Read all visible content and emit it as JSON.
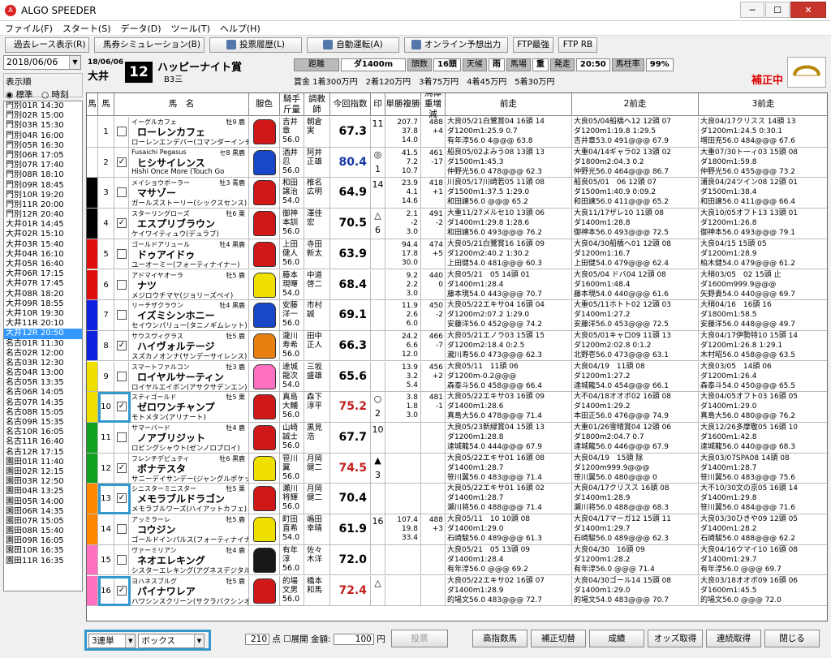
{
  "app": {
    "title": "ALGO SPEEDER"
  },
  "menu": [
    "ファイル(F)",
    "スタート(S)",
    "データ(D)",
    "ツール(T)",
    "ヘルプ(H)"
  ],
  "toolbar": [
    "過去レース表示(R)",
    "馬券シミュレーション(B)",
    "投票履歴(L)",
    "自動運転(A)",
    "オンライン予想出力",
    "FTP最強",
    "FTP RB"
  ],
  "sidebar": {
    "date": "2018/06/06",
    "order_label": "表示順",
    "radio1": "標準",
    "radio2": "時刻",
    "races": [
      "門別01R 14:30",
      "門別02R 15:00",
      "門別03R 15:30",
      "門別04R 16:00",
      "門別05R 16:30",
      "門別06R 17:05",
      "門別07R 17:40",
      "門別08R 18:10",
      "門別09R 18:45",
      "門別10R 19:20",
      "門別11R 20:00",
      "門別12R 20:40",
      "大井01R 14:45",
      "大井02R 15:10",
      "大井03R 15:40",
      "大井04R 16:10",
      "大井05R 16:40",
      "大井06R 17:15",
      "大井07R 17:45",
      "大井08R 18:20",
      "大井09R 18:55",
      "大井10R 19:30",
      "大井11R 20:10",
      "大井12R 20:50",
      "名古01R 11:30",
      "名古02R 12:00",
      "名古03R 12:30",
      "名古04R 13:00",
      "名古05R 13:35",
      "名古06R 14:05",
      "名古07R 14:35",
      "名古08R 15:05",
      "名古09R 15:35",
      "名古10R 16:05",
      "名古11R 16:40",
      "名古12R 17:15",
      "園田01R 11:40",
      "園田02R 12:15",
      "園田03R 12:50",
      "園田04R 13:25",
      "園田05R 14:00",
      "園田06R 14:35",
      "園田07R 15:05",
      "園田08R 15:40",
      "園田09R 16:05",
      "園田10R 16:35",
      "園田11R 16:35"
    ],
    "selected_index": 23
  },
  "race": {
    "date": "18/06/06",
    "place": "大井",
    "number": "12",
    "name": "ハッピーナイト賞",
    "class": "B3三",
    "distance_label": "距離",
    "distance": "ダ1400m",
    "heads_label": "頭数",
    "heads": "16頭",
    "weather_label": "天候",
    "weather": "雨",
    "baba_label": "馬場",
    "baba": "重",
    "start_label": "発走",
    "start": "20:50",
    "bahashira_label": "馬柱率",
    "bahashira": "99%",
    "prize": "賞金 1着300万円　2着120万円　3着75万円　4着45万円　5着30万円",
    "hosei": "補正中"
  },
  "columns": [
    "馬",
    "馬",
    "馬　名",
    "服色",
    "騎手斤量",
    "調教師",
    "今回指数",
    "印",
    "単勝複勝",
    "馬体重増減",
    "前走",
    "2前走",
    "3前走"
  ],
  "colors": {
    "waku": [
      "#ffffff",
      "#000000",
      "#e01010",
      "#1020e0",
      "#f0e000",
      "#10a020",
      "#ff8800",
      "#ff70c0"
    ]
  },
  "horses": [
    {
      "n": "1",
      "w": 1,
      "chk": false,
      "sire": "イーグルカフェ",
      "sa": "牡9 鹿",
      "name": "ローレンカフェ",
      "dam": "ローレンエンデバー(コマンダーインチーフ)",
      "silk": "#d01818",
      "jk": "吉井\n章\n56.0",
      "tr": "朝倉\n実",
      "idx": "67.3",
      "ic": "#000",
      "mk": "",
      "od": "11",
      "odds": "207.7\n37.8\n14.0",
      "wt": "488\n+4",
      "p1": "大良05/21白鷺賞04 16頭 14\nダ1200m1:25.9 0.7\n有年淳56.0 4@@@ 63.8",
      "p2": "大良05/04船橋へ12 12頭 07\nダ1200m1:19.8 1:29.5\n吉井章53.0 491@@@ 67.9",
      "p3": "大良04/17クリスス 14頭 13\nダ1200m1:24.5 0:30.1\n増田充56.0 484@@@ 67.6"
    },
    {
      "n": "2",
      "w": 1,
      "chk": true,
      "sire": "Fusaichi Pegasus",
      "sa": "セ8 黒鹿",
      "name": "ヒシサイレンス",
      "dam": "Hishi Once More (Touch Go",
      "silk": "#1848c8",
      "jk": "酒井\n忍\n56.0",
      "tr": "阿井\n正雄",
      "idx": "80.4",
      "ic": "#1838a8",
      "mk": "◎",
      "od": "1",
      "odds": "41.5\n7.2\n10.7",
      "wt": "461\n-17",
      "p1": "船良05/02よみう08 13頭 13\nダ1500m1:45.3\n仲野光56.0 478@@@ 62.3",
      "p2": "大重04/14ギャラ02 13頭 02\nダ1800m2:04.3 0.2\n仲野光56.0 464@@@ 86.7",
      "p3": "大重07/30ト一ィ03 15頭 08\nダ1800m1:59.8\n仲野光56.0 455@@@ 73.2"
    },
    {
      "n": "3",
      "w": 2,
      "chk": false,
      "sire": "メイショウボーラー",
      "sa": "牡3 青鹿",
      "name": "マサゾー",
      "dam": "ガールズストーリー(シックスセンス)",
      "silk": "#d01818",
      "jk": "和田\n譲治\n54.0",
      "tr": "椎名\n広明",
      "idx": "64.9",
      "ic": "#000",
      "mk": "",
      "od": "14",
      "odds": "23.9\n4.1\n14.6",
      "wt": "418\n+1",
      "p1": "川良05/17川崎若05 11頭 08\nダ1500m1:37.5 1:29.0\n和田譲56.0 @@@ 65.2",
      "p2": "船良05/01　06 12頭 07\nダ1500m1:40.9 0:09.2\n和田譲56.0 411@@@ 65.2",
      "p3": "浦良04/24ツイン08 12頭 01\nダ1500m1:38.4\n和田譲56.0 411@@@ 66.4"
    },
    {
      "n": "4",
      "w": 2,
      "chk": true,
      "sire": "スターリングローズ",
      "sa": "牡6 栗",
      "name": "エスプリブラウン",
      "dam": "ケイワイティュウ(デュラブ)",
      "silk": "#d01818",
      "jk": "御神\n本訓\n56.0",
      "tr": "澤佳\n宏",
      "idx": "70.5",
      "ic": "#000",
      "mk": "△",
      "od": "6",
      "odds": "2.1\n-2\n3.0",
      "wt": "491\n-2",
      "p1": "大重11/27メルセ10 13頭 06\nダ1400m1:29.8 1:28.6\n和田譲56.0 493@@@ 76.2",
      "p2": "大良11/17ザレ10 11頭 08\nダ1400m1:28.8\n御神本56.0 493@@@ 72.5",
      "p3": "大良10/05オフト13 13頭 01\nダ1200m1:26.8\n御神本56.0 493@@@ 79.1"
    },
    {
      "n": "5",
      "w": 3,
      "chk": false,
      "sire": "ゴールドアリュール",
      "sa": "牡4 黒鹿",
      "name": "ドゥアイドゥ",
      "dam": "ユーオーミー(フォーティナイナー)",
      "silk": "#d01818",
      "jk": "上田\n健人\n56.0",
      "tr": "寺田\n新太",
      "idx": "63.9",
      "ic": "#000",
      "mk": "",
      "od": "",
      "odds": "94.4\n17.8\n30.0",
      "wt": "474\n+5",
      "p1": "大良05/21白鷺賞16 16頭 09\nダ1200m2:40.2 1:30.2\n上田健54.0 481@@@ 60.3",
      "p2": "大良04/30船橋へ01 12頭 08\nダ1200m1:16.7\n上田健54.0 479@@@ 62.4",
      "p3": "大良04/15 15頭 05\nダ1200m1:28.9\n柏木健54.0 479@@@ 61.2"
    },
    {
      "n": "6",
      "w": 3,
      "chk": false,
      "sire": "アドマイヤオーラ",
      "sa": "牡5 鹿",
      "name": "ナツ",
      "dam": "メジロウチマヤ(ジョリーズベイ)",
      "silk": "#f0e000",
      "jk": "藤本\n現暉\n54.0",
      "tr": "中道\n啓二",
      "idx": "68.4",
      "ic": "#000",
      "mk": "",
      "od": "",
      "odds": "9.2\n2.2\n3.0",
      "wt": "440\n0",
      "p1": "大良05/21　05 14頭 01\nダ1400m1:28.4\n藤本現54.0 443@@@ 70.7",
      "p2": "大良05/04 ドバ04 12頭 08\nダ1600m1:48.4\n藤本現54.0 440@@@ 61.6",
      "p3": "大稍03/05　02 15頭 止\nダ1600m999.9@@@\n矢野貴54.0 440@@@ 69.7"
    },
    {
      "n": "7",
      "w": 4,
      "chk": false,
      "sire": "リーチザクラウン",
      "sa": "牡4 黒鹿",
      "name": "イズミシンホニー",
      "dam": "セイウンパリュー(タニノギムレット)",
      "silk": "#1848c8",
      "jk": "安藤\n洋一\n56.0",
      "tr": "市村\n誠",
      "idx": "69.1",
      "ic": "#000",
      "mk": "",
      "od": "",
      "odds": "11.9\n2.6\n6.0",
      "wt": "450\n-2",
      "p1": "大良05/22エキサ04 16頭 04\nダ1200m2:07.2 1:29.0\n安藤洋56.0 452@@@ 74.2",
      "p2": "大重05/11ホトト02 12頭 03\nダ1400m1:27.2\n安藤洋56.0 453@@@ 72.5",
      "p3": "大稍04/16　16頭 16\nダ1800m1:58.5\n安藤洋56.0 448@@@ 49.7"
    },
    {
      "n": "8",
      "w": 4,
      "chk": true,
      "sire": "サウスヴィグラス",
      "sa": "牡5 鹿",
      "name": "ハイヴォルテージ",
      "dam": "スズカノオンナ(サンデーサイレンス)",
      "silk": "#e88010",
      "jk": "瀧川\n寿希\n56.0",
      "tr": "田中\n正人",
      "idx": "66.3",
      "ic": "#000",
      "mk": "",
      "od": "",
      "odds": "24.2\n6.6\n12.0",
      "wt": "466\n-7",
      "p1": "大良05/21エノラ03 15頭 15\nダ1200m2:18.4 0:2.5\n瀧川寿56.0 473@@@ 62.3",
      "p2": "大良05/01キャロ09 11頭 13\nダ1200m2:02.8 0:1.2\n北野壱56.0 473@@@ 63.1",
      "p3": "大良04/17伊勢特10 15頭 14\nダ1200m1:26.8 1:29.1\n木村昭56.0 458@@@ 63.5"
    },
    {
      "n": "9",
      "w": 5,
      "chk": false,
      "sire": "スマートファルコン",
      "sa": "牡3 鹿",
      "name": "ロイヤルサーティン",
      "dam": "ロイヤルエイボン(アサクサデンエン)",
      "silk": "#ff70c0",
      "jk": "達城\n龍次\n54.0",
      "tr": "三坂\n盛雄",
      "idx": "65.6",
      "ic": "#000",
      "mk": "",
      "od": "",
      "odds": "13.9\n3.2\n5.4",
      "wt": "456\n+2",
      "p1": "大良05/11　11頭 06\nダ1200m-0.2@@@\n森泰斗56.0 458@@@ 66.4",
      "p2": "大良04/19　11頭 08\nダ1200m1:27.2\n達城龍54.0 454@@@ 66.1",
      "p3": "大良03/05　14頭 06\nダ1200m1:26.4\n森泰斗54.0 450@@@ 65.5"
    },
    {
      "n": "10",
      "w": 5,
      "chk": true,
      "sire": "スティゴールド",
      "sa": "牡5 栗",
      "name": "ゼロワンチャンプ",
      "dam": "モトメタン(アリナート)",
      "silk": "#d01818",
      "jk": "真島\n大輔\n56.0",
      "tr": "森下\n淳平",
      "idx": "75.2",
      "ic": "#c02020",
      "mk": "○",
      "od": "2",
      "odds": "3.8\n1.8\n3.0",
      "wt": "481\n-1",
      "p1": "大良05/22エキサ03 16頭 09\nダ1400m1:28.6\n真島大56.0 478@@@ 71.4",
      "p2": "大不04/18オオボ02 16頭 08\nダ1400m1:29.2\n本田正56.0 476@@@ 74.9",
      "p3": "大良04/05オフト03 16頭 05\nダ1400m1:29.0\n真島大56.0 480@@@ 76.2"
    },
    {
      "n": "11",
      "w": 6,
      "chk": false,
      "sire": "サマーバード",
      "sa": "牡4 鹿",
      "name": "ノアブリジット",
      "dam": "ロビングシャウト(ゼンノロブロイ)",
      "silk": "#d01818",
      "jk": "山崎\n誠士\n56.0",
      "tr": "黒見\n浩",
      "idx": "67.7",
      "ic": "#000",
      "mk": "",
      "od": "10",
      "odds": "",
      "wt": "",
      "p1": "大良05/23新緑賞04 15頭 13\nダ1200m1:28.8\n達城龍54.0 444@@@ 67.9",
      "p2": "大重01/26雪晴賞04 12頭 06\nダ1800m2:04.7 0.7\n達城龍56.0 446@@@ 67.9",
      "p3": "大良12/26多摩敬05 16頭 10\nダ1600m1:42.8\n達城龍56.0 440@@@ 68.3"
    },
    {
      "n": "12",
      "w": 6,
      "chk": true,
      "sire": "フレンチデピュティ",
      "sa": "牡6 黒鹿",
      "name": "ボナテスタ",
      "dam": "サニーデイサンデー(ジャングルポケット)",
      "silk": "#f0e000",
      "jk": "笹川\n翼\n56.0",
      "tr": "月岡\n健二",
      "idx": "74.5",
      "ic": "#c02020",
      "mk": "▲",
      "od": "3",
      "odds": "",
      "wt": "",
      "p1": "大良05/22エキサ01 16頭 08\nダ1400m1:28.7\n笹川翼56.0 483@@@ 71.4",
      "p2": "大良04/19　15頭 除\nダ1200m999.9@@@\n笹川翼56.0 480@@@ 0",
      "p3": "大良03/07SPA08 14頭 08\nダ1400m1:28.7\n笹川翼56.0 483@@@ 75.6"
    },
    {
      "n": "13",
      "w": 7,
      "chk": true,
      "sire": "シニスターミニスター",
      "sa": "牡5 栗",
      "name": "メモラブルドラゴン",
      "dam": "メモラブルワーズ(ハイアットカフェ)",
      "silk": "#d01818",
      "jk": "瀬川\n将輝\n56.0",
      "tr": "月岡\n健二",
      "idx": "70.4",
      "ic": "#000",
      "mk": "",
      "od": "",
      "odds": "",
      "wt": "",
      "p1": "大良05/22エキサ01 16頭 02\nダ1400m1:28.7\n瀬川将56.0 488@@@ 71.4",
      "p2": "大良04/17クリスス 16頭 08\nダ1400m1:28.9\n瀬川将56.0 488@@@ 68.3",
      "p3": "大不10/30文の京05 16頭 14\nダ1400m1:29.8\n笹川翼56.0 484@@@ 71.6"
    },
    {
      "n": "14",
      "w": 7,
      "chk": false,
      "sire": "アッミラーレ",
      "sa": "牡5 鹿",
      "name": "コウジン",
      "dam": "ゴールドインパルス(フォーティナイナー)",
      "silk": "#f0e000",
      "jk": "町田\n直希\n54.0",
      "tr": "嶋田\n幸晴",
      "idx": "61.9",
      "ic": "#000",
      "mk": "",
      "od": "16",
      "odds": "107.4\n19.8\n33.4",
      "wt": "488\n+3",
      "p1": "大良05/11　10 10頭 08\nダ1400m1:29.0\n石崎駿56.0 489@@@ 61.3",
      "p2": "大良04/17マーガ12 15頭 11\nダ1400m1:29.7\n石崎駿56.0 489@@@ 62.3",
      "p3": "大良03/30ひきや09 12頭 05\nダ1400m1:28.2\n石崎駿56.0 488@@@ 62.2"
    },
    {
      "n": "15",
      "w": 8,
      "chk": false,
      "sire": "ヴァーミリアン",
      "sa": "牡4 鹿",
      "name": "ネオエレキング",
      "dam": "シスターエレキング(アグネスデジタル)",
      "silk": "#181818",
      "jk": "有年\n淳\n56.0",
      "tr": "佐々\n木洋",
      "idx": "72.0",
      "ic": "#000",
      "mk": "",
      "od": "",
      "odds": "",
      "wt": "",
      "p1": "大良05/21　05 13頭 09\nダ1400m1:28.4\n有年淳56.0 @@@ 69.2",
      "p2": "大良04/30　16頭 09\nダ1200m1:28.2\n有年淳56.0 @@@ 71.4",
      "p3": "大良04/16ウマイ10 16頭 08\nダ1400m1:29.7\n有年淳56.0 @@@ 69.7"
    },
    {
      "n": "16",
      "w": 8,
      "chk": true,
      "sire": "ヨハネスブルグ",
      "sa": "牡5 鹿",
      "name": "パイナワレア",
      "dam": "ハワシンスクリーン(サクラバクシンオー)",
      "silk": "#d01818",
      "jk": "的場\n文男\n56.0",
      "tr": "橋本\n和馬",
      "idx": "72.4",
      "ic": "#c02020",
      "mk": "△",
      "od": "",
      "odds": "",
      "wt": "",
      "p1": "大良05/22エキサ02 16頭 07\nダ1400m1:28.9\n的場文56.0 483@@@ 72.7",
      "p2": "大良04/30ゴール14 15頭 08\nダ1400m1:29.0\n的場文54.0 483@@@ 70.7",
      "p3": "大良03/18オオボ09 16頭 06\nダ1600m1:45.5\n的場文56.0 @@@ 72.0"
    }
  ],
  "bottom": {
    "bettype": "3連単",
    "method": "ボックス",
    "points": "210",
    "points_unit": "点",
    "tenkai_label": "展開",
    "amount_label": "金額:",
    "amount": "100",
    "yen": "円",
    "vote": "投票",
    "high_idx": "高指数馬",
    "hosei_kiri": "補正切替",
    "seiseki": "成績",
    "odds_get": "オッズ取得",
    "renzoku": "連続取得",
    "close": "閉じる"
  }
}
